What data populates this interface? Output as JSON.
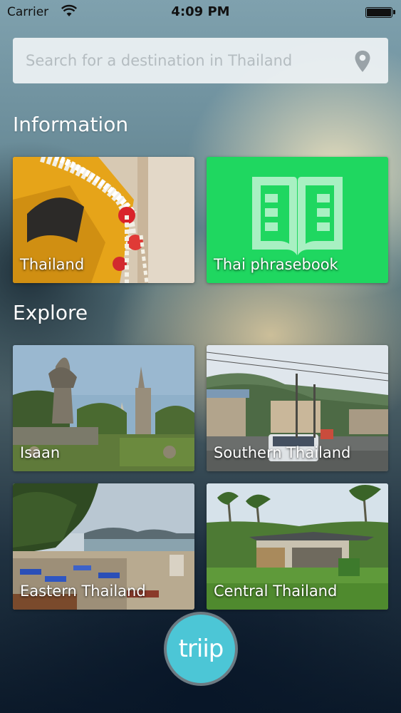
{
  "status_bar": {
    "carrier": "Carrier",
    "time": "4:09 PM",
    "icons": [
      "wifi-icon",
      "battery-icon"
    ]
  },
  "search": {
    "placeholder": "Search for a destination in Thailand",
    "value": "",
    "icon": "location-pin-icon"
  },
  "sections": {
    "information": {
      "title": "Information",
      "tiles": [
        {
          "label": "Thailand"
        },
        {
          "label": "Thai phrasebook",
          "icon": "book-icon",
          "color": "#1fd760"
        }
      ]
    },
    "explore": {
      "title": "Explore",
      "tiles": [
        {
          "label": "Isaan"
        },
        {
          "label": "Southern Thailand"
        },
        {
          "label": "Eastern Thailand"
        },
        {
          "label": "Central Thailand"
        }
      ]
    }
  },
  "logo": {
    "text": "triip",
    "color": "#4cc6d6"
  }
}
